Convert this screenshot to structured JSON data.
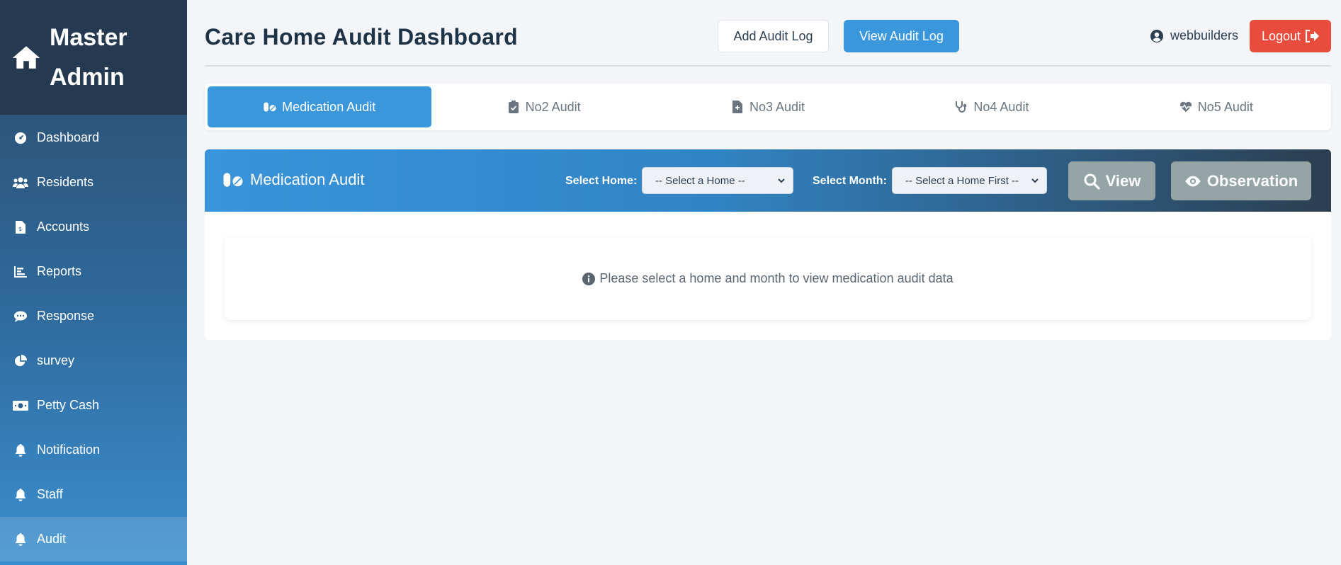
{
  "sidebar": {
    "brand_line1": "Master",
    "brand_line2": "Admin",
    "brand_icon": "home-icon",
    "items": [
      {
        "label": "Dashboard",
        "icon": "gauge-icon"
      },
      {
        "label": "Residents",
        "icon": "users-icon"
      },
      {
        "label": "Accounts",
        "icon": "invoice-icon"
      },
      {
        "label": "Reports",
        "icon": "bar-chart-icon"
      },
      {
        "label": "Response",
        "icon": "comments-icon"
      },
      {
        "label": "survey",
        "icon": "pie-chart-icon"
      },
      {
        "label": "Petty Cash",
        "icon": "money-icon"
      },
      {
        "label": "Notification",
        "icon": "bell-icon"
      },
      {
        "label": "Staff",
        "icon": "bell-icon"
      },
      {
        "label": "Audit",
        "icon": "bell-icon"
      }
    ],
    "active": "Audit"
  },
  "header": {
    "title": "Care Home Audit Dashboard",
    "add_audit_log": "Add Audit Log",
    "view_audit_log": "View Audit Log",
    "username": "webbuilders",
    "logout": "Logout"
  },
  "tabs": [
    {
      "label": "Medication Audit",
      "icon": "pills-icon"
    },
    {
      "label": "No2 Audit",
      "icon": "clipboard-check-icon"
    },
    {
      "label": "No3 Audit",
      "icon": "file-medical-icon"
    },
    {
      "label": "No4 Audit",
      "icon": "stethoscope-icon"
    },
    {
      "label": "No5 Audit",
      "icon": "heartbeat-icon"
    }
  ],
  "panel": {
    "title": "Medication Audit",
    "select_home_label": "Select Home:",
    "select_home_value": "-- Select a Home --",
    "select_month_label": "Select Month:",
    "select_month_value": "-- Select a Home First --",
    "view_button": "View",
    "observation_button": "Observation",
    "empty_message": "Please select a home and month to view medication audit data"
  },
  "colors": {
    "primary": "#3a97dc",
    "danger": "#e84c3d",
    "muted_button": "#95a5a6",
    "sidebar_dark": "#253a50"
  }
}
